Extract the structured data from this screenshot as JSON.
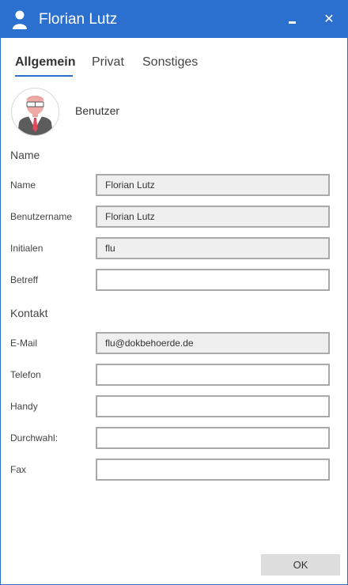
{
  "window": {
    "title": "Florian Lutz",
    "minimize_icon": "minimize-icon",
    "close_label": "✕"
  },
  "tabs": [
    {
      "label": "Allgemein",
      "active": true
    },
    {
      "label": "Privat",
      "active": false
    },
    {
      "label": "Sonstiges",
      "active": false
    }
  ],
  "avatar": {
    "icon": "user-avatar-icon",
    "caption": "Benutzer"
  },
  "sections": {
    "name": {
      "title": "Name",
      "fields": [
        {
          "label": "Name",
          "value": "Florian Lutz",
          "readonly": true
        },
        {
          "label": "Benutzername",
          "value": "Florian Lutz",
          "readonly": true
        },
        {
          "label": "Initialen",
          "value": "flu",
          "readonly": true
        },
        {
          "label": "Betreff",
          "value": "",
          "readonly": false
        }
      ]
    },
    "contact": {
      "title": "Kontakt",
      "fields": [
        {
          "label": "E-Mail",
          "value": "flu@dokbehoerde.de",
          "readonly": true
        },
        {
          "label": "Telefon",
          "value": "",
          "readonly": false
        },
        {
          "label": "Handy",
          "value": "",
          "readonly": false
        },
        {
          "label": "Durchwahl:",
          "value": "",
          "readonly": false
        },
        {
          "label": "Fax",
          "value": "",
          "readonly": false
        }
      ]
    }
  },
  "footer": {
    "ok_label": "OK"
  },
  "colors": {
    "titlebar": "#2b6fcf",
    "readonly_field": "#efefef",
    "field_border": "#a9a9a9",
    "button_bg": "#dddddd"
  }
}
